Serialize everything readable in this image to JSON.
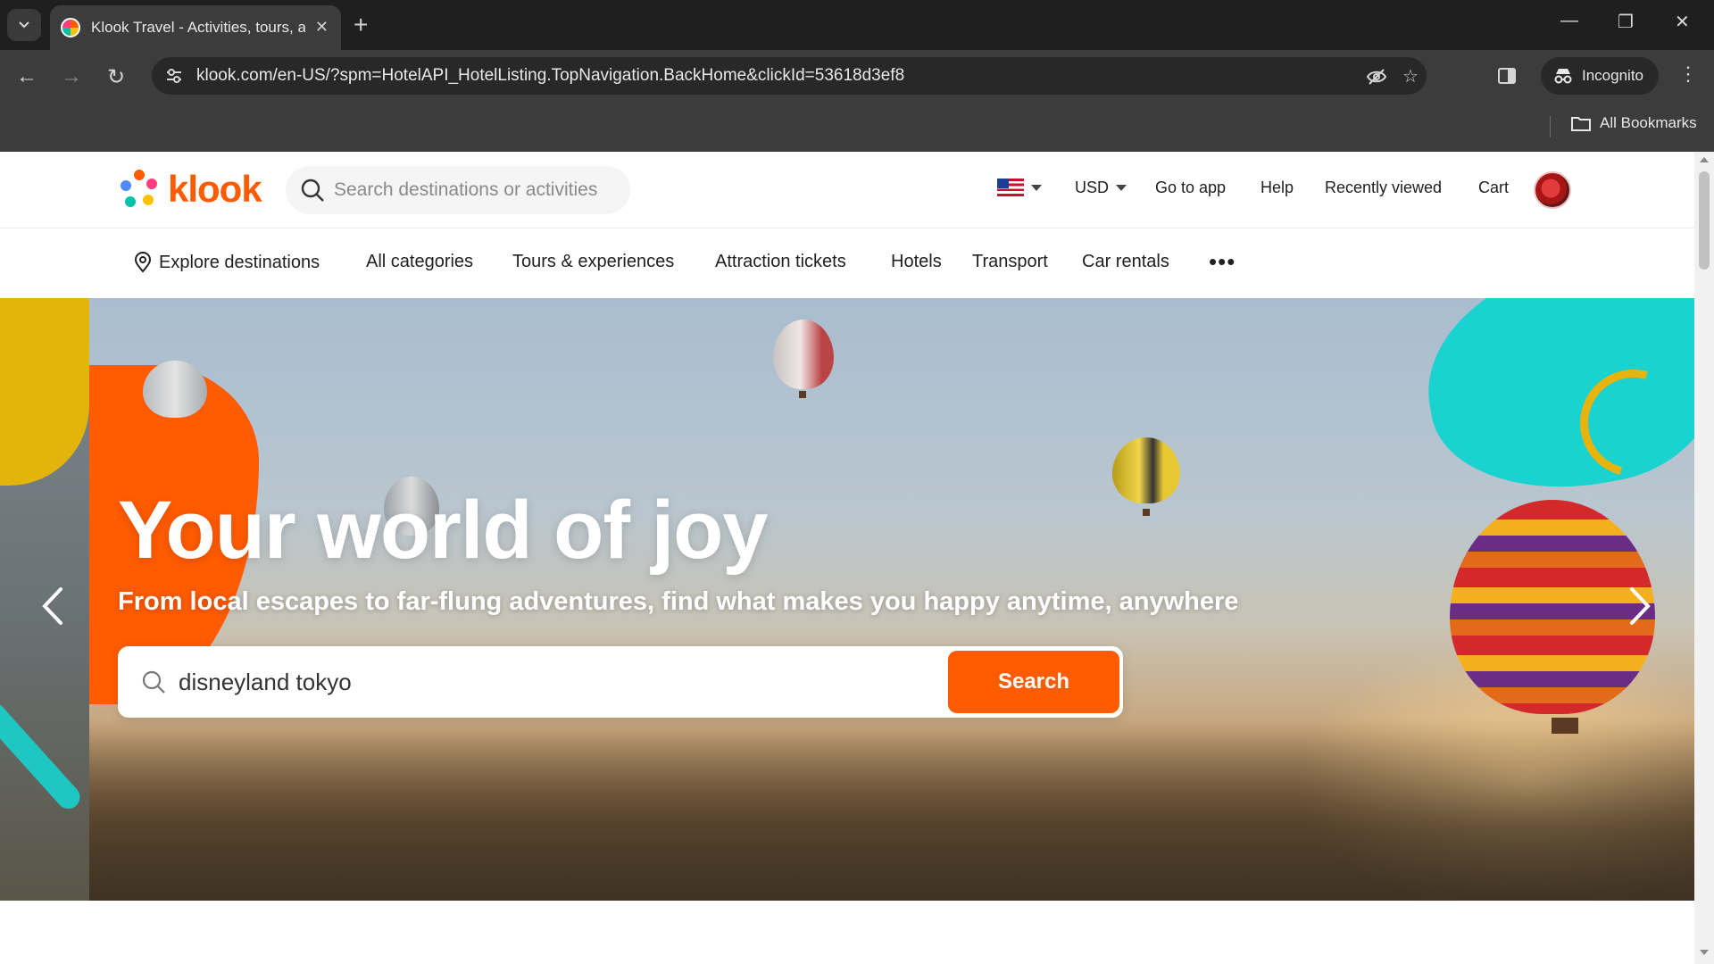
{
  "browser": {
    "tab_title": "Klook Travel - Activities, tours, a",
    "url": "klook.com/en-US/?spm=HotelAPI_HotelListing.TopNavigation.BackHome&clickId=53618d3ef8",
    "incognito_label": "Incognito",
    "bookmarks_label": "All Bookmarks"
  },
  "header": {
    "logo_text": "klook",
    "search_placeholder": "Search destinations or activities",
    "currency": "USD",
    "links": [
      "Go to app",
      "Help",
      "Recently viewed",
      "Cart"
    ]
  },
  "category_nav": {
    "items": [
      "Explore destinations",
      "All categories",
      "Tours & experiences",
      "Attraction tickets",
      "Hotels",
      "Transport",
      "Car rentals"
    ],
    "more": "•••"
  },
  "hero": {
    "title": "Your world of joy",
    "subtitle": "From local escapes to far-flung adventures, find what makes you happy anytime, anywhere",
    "search_value": "disneyland tokyo",
    "search_button": "Search"
  },
  "colors": {
    "brand": "#ff5b00",
    "teal": "#1ad3d0",
    "yellow": "#e2b40c"
  }
}
